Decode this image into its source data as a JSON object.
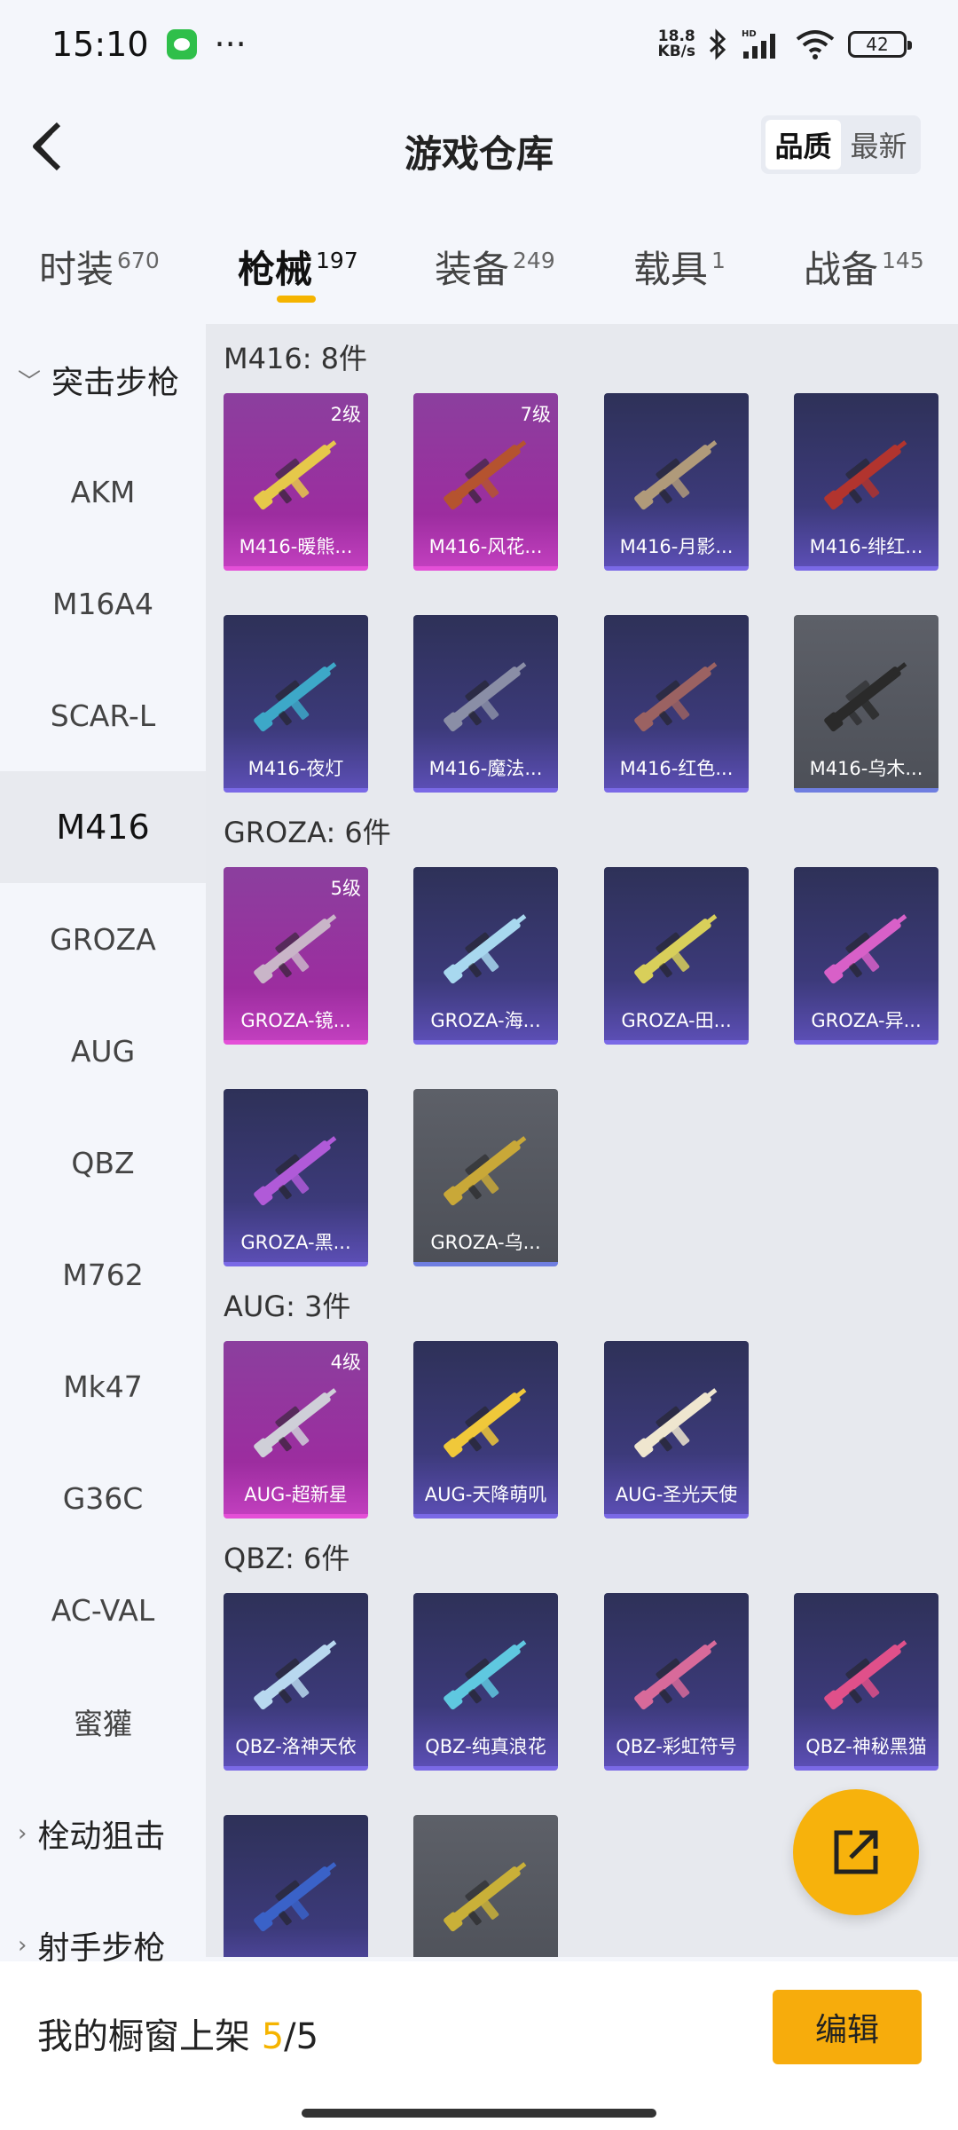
{
  "status_bar": {
    "time": "15:10",
    "net_speed_value": "18.8",
    "net_speed_unit": "KB/s",
    "network_label": "HD",
    "battery": "42"
  },
  "header": {
    "title": "游戏仓库",
    "sort_options": [
      "品质",
      "最新"
    ],
    "sort_selected": "品质"
  },
  "tabs": [
    {
      "label": "时装",
      "count": "670"
    },
    {
      "label": "枪械",
      "count": "197",
      "active": true
    },
    {
      "label": "装备",
      "count": "249"
    },
    {
      "label": "载具",
      "count": "1"
    },
    {
      "label": "战备",
      "count": "145"
    }
  ],
  "sidebar": {
    "items": [
      {
        "label": "突击步枪",
        "type": "group",
        "expanded": true
      },
      {
        "label": "AKM"
      },
      {
        "label": "M16A4"
      },
      {
        "label": "SCAR-L"
      },
      {
        "label": "M416",
        "active": true
      },
      {
        "label": "GROZA"
      },
      {
        "label": "AUG"
      },
      {
        "label": "QBZ"
      },
      {
        "label": "M762"
      },
      {
        "label": "Mk47"
      },
      {
        "label": "G36C"
      },
      {
        "label": "AC-VAL"
      },
      {
        "label": "蜜獾"
      },
      {
        "label": "栓动狙击",
        "type": "group",
        "expanded": false
      },
      {
        "label": "射手步枪",
        "type": "group",
        "expanded": false
      }
    ]
  },
  "sections": [
    {
      "title": "M416: 8件",
      "items": [
        {
          "name": "M416-暖熊...",
          "level": "2级",
          "rarity": "pink",
          "color": "#e6c84a"
        },
        {
          "name": "M416-风花...",
          "level": "7级",
          "rarity": "pink",
          "color": "#b5532f"
        },
        {
          "name": "M416-月影...",
          "rarity": "purple",
          "color": "#b09a7a"
        },
        {
          "name": "M416-绯红...",
          "rarity": "purple",
          "color": "#b2342e"
        },
        {
          "name": "M416-夜灯",
          "rarity": "purple",
          "color": "#3da8c8"
        },
        {
          "name": "M416-魔法...",
          "rarity": "purple",
          "color": "#8a8ea6"
        },
        {
          "name": "M416-红色...",
          "rarity": "purple",
          "color": "#9b6262"
        },
        {
          "name": "M416-乌木...",
          "rarity": "gray",
          "color": "#2a2a2a"
        }
      ]
    },
    {
      "title": "GROZA: 6件",
      "items": [
        {
          "name": "GROZA-镜...",
          "level": "5级",
          "rarity": "pink",
          "color": "#c9b5c8"
        },
        {
          "name": "GROZA-海...",
          "rarity": "purple",
          "color": "#a8d8ef"
        },
        {
          "name": "GROZA-田...",
          "rarity": "purple",
          "color": "#d8cf5a"
        },
        {
          "name": "GROZA-异...",
          "rarity": "purple",
          "color": "#d860c8"
        },
        {
          "name": "GROZA-黑...",
          "rarity": "purple",
          "color": "#b05ad8"
        },
        {
          "name": "GROZA-乌...",
          "rarity": "gray",
          "color": "#c9a838"
        }
      ]
    },
    {
      "title": "AUG: 3件",
      "items": [
        {
          "name": "AUG-超新星",
          "level": "4级",
          "rarity": "pink",
          "color": "#cfcfd8"
        },
        {
          "name": "AUG-天降萌叽",
          "rarity": "purple",
          "color": "#f0c83a"
        },
        {
          "name": "AUG-圣光天使",
          "rarity": "purple",
          "color": "#efe6cf"
        }
      ]
    },
    {
      "title": "QBZ: 6件",
      "items": [
        {
          "name": "QBZ-洛神天依",
          "rarity": "purple",
          "color": "#b8d8ef"
        },
        {
          "name": "QBZ-纯真浪花",
          "rarity": "purple",
          "color": "#5fc8e0"
        },
        {
          "name": "QBZ-彩虹符号",
          "rarity": "purple",
          "color": "#d86a9a"
        },
        {
          "name": "QBZ-神秘黑猫",
          "rarity": "purple",
          "color": "#e0508a"
        },
        {
          "name": "",
          "rarity": "purple",
          "color": "#3a62c8"
        },
        {
          "name": "",
          "rarity": "gray",
          "color": "#c9b038"
        }
      ]
    }
  ],
  "bottom_bar": {
    "showcase_label": "我的橱窗上架",
    "current": "5",
    "separator": "/",
    "total": "5",
    "edit_label": "编辑"
  },
  "colors": {
    "accent": "#f5b400",
    "rarity_pink": "#e44fd7",
    "rarity_purple": "#7a69e6",
    "rarity_gray": "#6f7ee0"
  },
  "icons": {
    "back": "back-arrow-icon",
    "share": "share-export-icon",
    "wechat": "wechat-icon",
    "bluetooth": "bluetooth-icon",
    "signal": "signal-icon",
    "wifi": "wifi-icon",
    "battery": "battery-icon"
  }
}
